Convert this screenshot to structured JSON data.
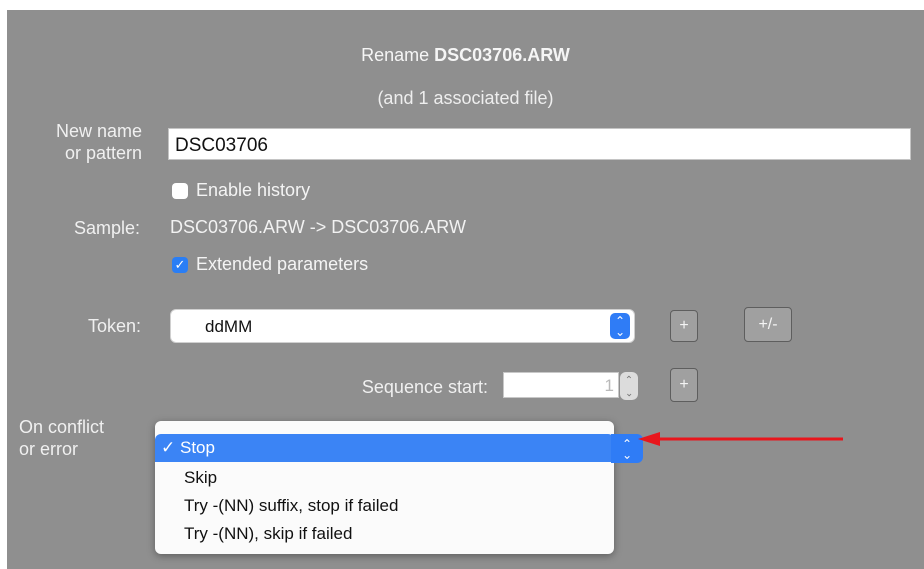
{
  "dialog": {
    "title_prefix": "Rename ",
    "title_filename": "DSC03706.ARW",
    "subtitle": "(and 1 associated file)"
  },
  "new_name": {
    "label_line1": "New name",
    "label_line2": "or pattern",
    "value": "DSC03706"
  },
  "enable_history": {
    "label": "Enable history",
    "checked": false
  },
  "sample": {
    "label": "Sample:",
    "value": "DSC03706.ARW -> DSC03706.ARW"
  },
  "extended_parameters": {
    "label": "Extended parameters",
    "checked": true
  },
  "token": {
    "label": "Token:",
    "selected": "ddMM",
    "add_button": "+",
    "plusminus_button": "+/-"
  },
  "sequence_start": {
    "label": "Sequence start:",
    "value": "1",
    "add_button": "+"
  },
  "on_conflict": {
    "label_line1": "On conflict",
    "label_line2": "or error",
    "checkmark": "✓",
    "options": [
      "Stop",
      "Skip",
      "Try -(NN) suffix, stop if failed",
      "Try -(NN), skip if failed"
    ],
    "selected_index": 0
  },
  "colors": {
    "panel_bg": "#8f8f8f",
    "accent_blue": "#2f7cf6",
    "annotation_arrow": "#e8161c"
  },
  "icons": {
    "popup_stepper": "up-down-chevron-icon",
    "checkbox_check": "checkmark-icon",
    "annotation": "red-arrow-icon"
  }
}
